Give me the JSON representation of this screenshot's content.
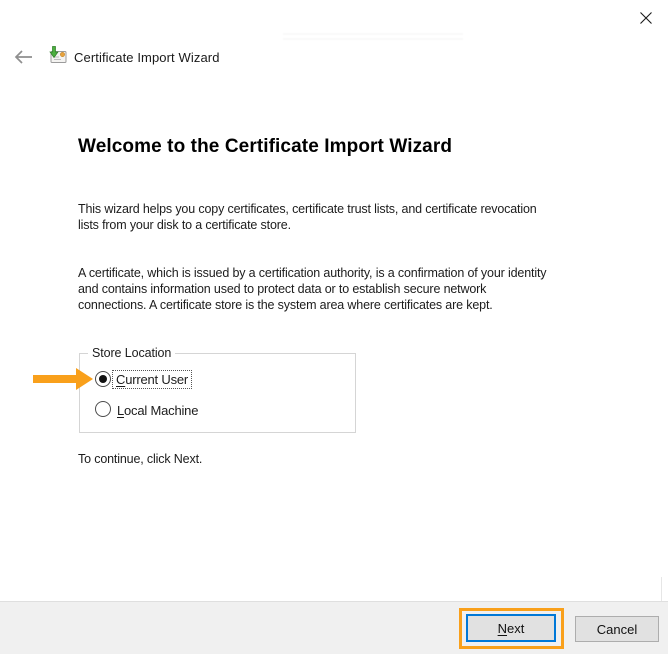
{
  "window": {
    "title": "Certificate Import Wizard"
  },
  "icons": {
    "close": "close-icon (thin x glyph)",
    "back": "back-arrow-icon (left arrow, disabled gray)",
    "certificate_import": "certificate-import-icon (certificate card with gold seal and green arrow)"
  },
  "colors": {
    "annotation_orange": "#F9A01B",
    "default_button_border_blue": "#0078D7",
    "button_face": "#E1E1E1",
    "footer_background": "#F0F0F0"
  },
  "header": {
    "title": "Certificate Import Wizard"
  },
  "main": {
    "heading": "Welcome to the Certificate Import Wizard",
    "paragraph1": "This wizard helps you copy certificates, certificate trust lists, and certificate revocation\nlists from your disk to a certificate store.",
    "paragraph2": "A certificate, which is issued by a certification authority, is a confirmation of your identity\nand contains information used to protect data or to establish secure network\nconnections. A certificate store is the system area where certificates are kept.",
    "store_location": {
      "label": "Store Location",
      "options": [
        {
          "label": "Current User",
          "label_first": "C",
          "label_rest": "urrent User",
          "selected": true,
          "focused": true
        },
        {
          "label": "Local Machine",
          "label_first": "L",
          "label_rest": "ocal Machine",
          "selected": false,
          "focused": false
        }
      ]
    },
    "instruction": "To continue, click Next."
  },
  "footer": {
    "next": {
      "label": "Next",
      "label_first": "N",
      "label_rest": "ext",
      "is_default": true,
      "highlighted": true
    },
    "cancel": {
      "label": "Cancel"
    }
  }
}
